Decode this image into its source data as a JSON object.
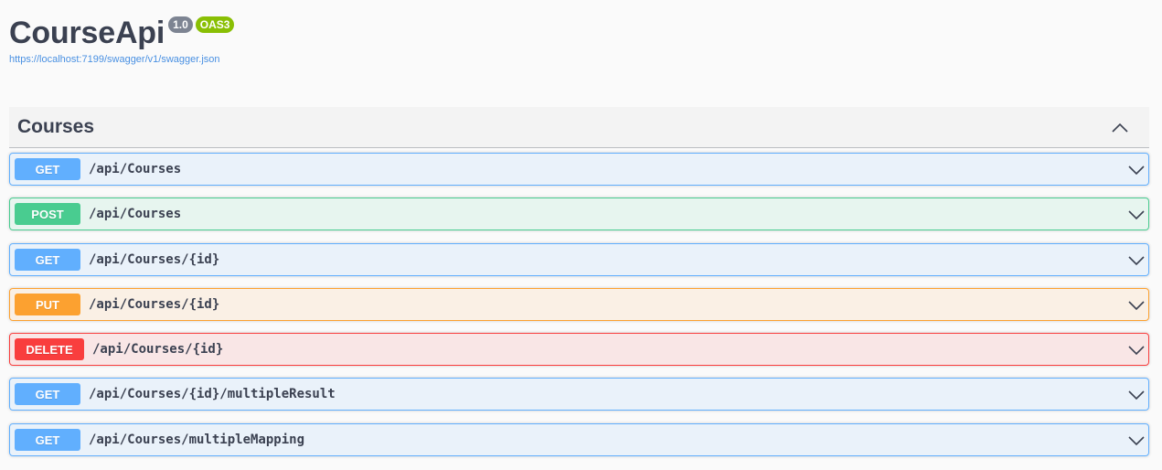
{
  "info": {
    "title": "CourseApi",
    "version": "1.0",
    "oas": "OAS3",
    "spec_url": "https://localhost:7199/swagger/v1/swagger.json"
  },
  "tag": {
    "name": "Courses",
    "expanded": true
  },
  "operations": [
    {
      "method": "GET",
      "path": "/api/Courses"
    },
    {
      "method": "POST",
      "path": "/api/Courses"
    },
    {
      "method": "GET",
      "path": "/api/Courses/{id}"
    },
    {
      "method": "PUT",
      "path": "/api/Courses/{id}"
    },
    {
      "method": "DELETE",
      "path": "/api/Courses/{id}"
    },
    {
      "method": "GET",
      "path": "/api/Courses/{id}/multipleResult"
    },
    {
      "method": "GET",
      "path": "/api/Courses/multipleMapping"
    }
  ],
  "colors": {
    "get": "#61affe",
    "post": "#49cc90",
    "put": "#fca130",
    "delete": "#f93e3e",
    "link": "#4990e2"
  },
  "icons": {
    "tag_toggle": "chevron-up-icon",
    "operation_toggle": "chevron-down-icon"
  }
}
